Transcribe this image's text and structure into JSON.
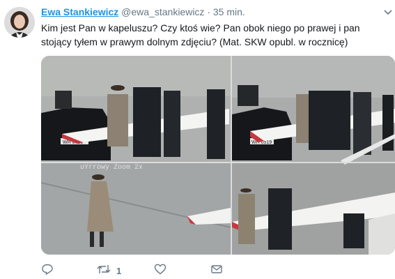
{
  "tweet": {
    "display_name": "Ewa Stankiewicz",
    "handle": "@ewa_stankiewicz",
    "separator": "·",
    "time": "35 min.",
    "text": "Kim jest Pan w kapeluszu? Czy ktoś wie? Pan obok niego po prawej i pan stojący tyłem w prawym dolnym zdjęciu? (Mat. SKW opubl. w rocznicę)",
    "media": {
      "plate_left": "WH 0719",
      "plate_right": "WH 0519",
      "overlay_text": "uYrrowy Zoom 2x"
    },
    "actions": {
      "reply_count": "",
      "retweet_count": "1",
      "like_count": ""
    }
  },
  "colors": {
    "link": "#1b95e0",
    "secondary_text": "#657786"
  },
  "icons": [
    "reply-icon",
    "retweet-icon",
    "like-icon",
    "direct-message-icon",
    "chevron-down-icon"
  ]
}
